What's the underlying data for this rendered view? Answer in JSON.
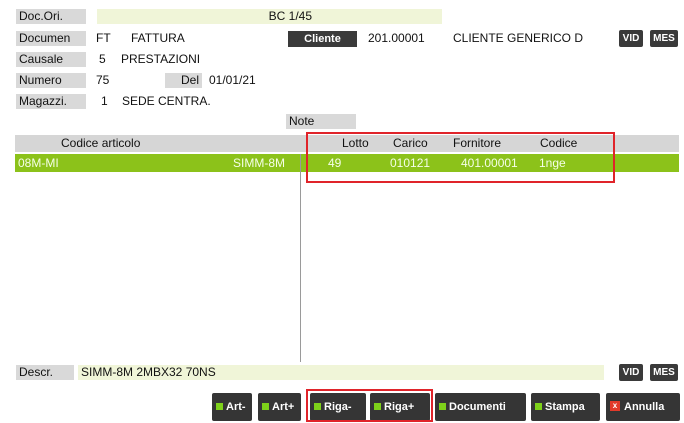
{
  "header": {
    "doc_ori_label": "Doc.Ori.",
    "doc_ori_value": "BC 1/45",
    "documen_label": "Documen",
    "documen_code": "FT",
    "documen_name": "FATTURA",
    "cliente_button": "Cliente",
    "cliente_code": "201.00001",
    "cliente_name": "CLIENTE GENERICO D",
    "vid_label": "VID",
    "mes_label": "MES",
    "causale_label": "Causale",
    "causale_code": "5",
    "causale_name": "PRESTAZIONI",
    "numero_label": "Numero",
    "numero_value": "75",
    "del_label": "Del",
    "del_value": "01/01/21",
    "magazzi_label": "Magazzi.",
    "magazzi_code": "1",
    "magazzi_name": "SEDE CENTRA.",
    "note_label": "Note"
  },
  "table": {
    "columns": {
      "codice_articolo": "Codice articolo",
      "lotto": "Lotto",
      "carico": "Carico",
      "fornitore": "Fornitore",
      "codice": "Codice"
    },
    "rows": [
      {
        "code": "08M-MI",
        "article": "SIMM-8M",
        "lotto": "49",
        "carico": "010121",
        "fornitore": "401.00001",
        "codice": "1nge"
      }
    ]
  },
  "footer": {
    "descr_label": "Descr.",
    "descr_value": "SIMM-8M 2MBX32 70NS",
    "vid_label": "VID",
    "mes_label": "MES"
  },
  "toolbar": {
    "art_minus": "Art-",
    "art_plus": "Art+",
    "riga_minus": "Riga-",
    "riga_plus": "Riga+",
    "documenti": "Documenti",
    "stampa": "Stampa",
    "annulla": "Annulla",
    "annulla_icon": "x"
  },
  "colors": {
    "selected_row": "#8cc21a",
    "highlight_box": "#e0242a",
    "button_bg": "#353535",
    "button_accent": "#7ed11a"
  }
}
